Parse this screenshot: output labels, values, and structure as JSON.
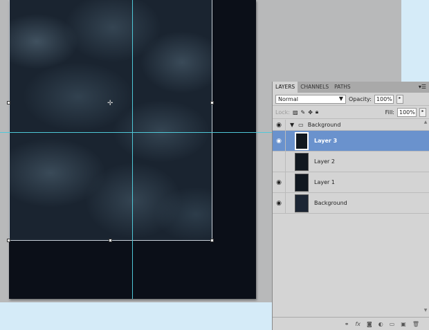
{
  "panel": {
    "tabs": [
      "LAYERS",
      "CHANNELS",
      "PATHS"
    ],
    "blend_mode": "Normal",
    "opacity_label": "Opacity:",
    "opacity": "100%",
    "lock_label": "Lock:",
    "fill_label": "Fill:",
    "fill": "100%",
    "group": {
      "name": "Background",
      "visible": true
    },
    "layers": [
      {
        "name": "Layer 3",
        "visible": true,
        "selected": true
      },
      {
        "name": "Layer 2",
        "visible": false,
        "selected": false
      },
      {
        "name": "Layer 1",
        "visible": true,
        "selected": false
      },
      {
        "name": "Background",
        "visible": true,
        "selected": false
      }
    ],
    "footer_icons": [
      "link-icon",
      "fx-icon",
      "mask-icon",
      "adjustment-icon",
      "folder-icon",
      "new-layer-icon",
      "trash-icon"
    ]
  }
}
